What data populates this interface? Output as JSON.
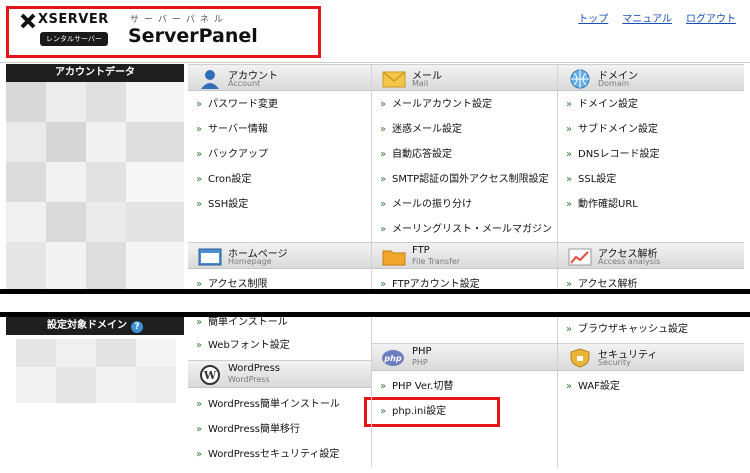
{
  "header": {
    "brand": "XSERVER",
    "badge": "レンタルサーバー",
    "kana": "サーバーパネル",
    "title": "ServerPanel",
    "links": [
      "トップ",
      "マニュアル",
      "ログアウト"
    ]
  },
  "sidebar": {
    "account_title": "アカウントデータ",
    "domain_title": "設定対象ドメイン"
  },
  "columns": {
    "account": {
      "name": "アカウント",
      "sub": "Account",
      "items": [
        "パスワード変更",
        "サーバー情報",
        "バックアップ",
        "Cron設定",
        "SSH設定"
      ]
    },
    "mail": {
      "name": "メール",
      "sub": "Mail",
      "items": [
        "メールアカウント設定",
        "迷惑メール設定",
        "自動応答設定",
        "SMTP認証の国外アクセス制限設定",
        "メールの振り分け",
        "メーリングリスト・メールマガジン"
      ]
    },
    "domain": {
      "name": "ドメイン",
      "sub": "Domain",
      "items": [
        "ドメイン設定",
        "サブドメイン設定",
        "DNSレコード設定",
        "SSL設定",
        "動作確認URL"
      ]
    },
    "homepage": {
      "name": "ホームページ",
      "sub": "Homepage",
      "items": [
        "アクセス制限",
        "簡単インストール",
        "Webフォント設定"
      ]
    },
    "ftp": {
      "name": "FTP",
      "sub": "File Transfer",
      "items": [
        "FTPアカウント設定"
      ]
    },
    "access": {
      "name": "アクセス解析",
      "sub": "Access analysis",
      "items": [
        "アクセス解析",
        "ブラウザキャッシュ設定"
      ]
    },
    "wordpress": {
      "name": "WordPress",
      "sub": "WordPress",
      "items": [
        "WordPress簡単インストール",
        "WordPress簡単移行",
        "WordPressセキュリティ設定"
      ]
    },
    "php": {
      "name": "PHP",
      "sub": "PHP",
      "items": [
        "PHP Ver.切替",
        "php.ini設定"
      ]
    },
    "security": {
      "name": "セキュリティ",
      "sub": "Security",
      "items": [
        "WAF設定"
      ]
    }
  },
  "colors": {
    "highlight": "#e8141b",
    "link": "#1a4fb8",
    "arrow": "#3a7a3a"
  }
}
